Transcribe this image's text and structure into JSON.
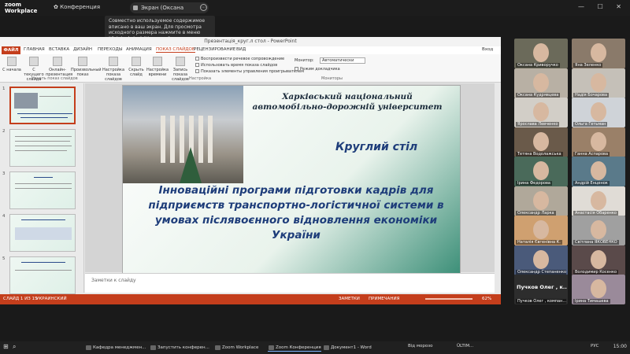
{
  "zoom": {
    "logo_line1": "zoom",
    "logo_line2": "Workplace",
    "conference": "Конференция",
    "share_label": "Экран (Оксана Криворучко)",
    "tooltip": "Совместно используемое содержимое вписано в ваш экран. Для просмотра исходного размера нажмите в меню \"Original size\" (Исходный...",
    "window_controls": "— ☐ ✕"
  },
  "ppt": {
    "title": "Презентація_круг.л стол - PowerPoint",
    "user": "Вход",
    "tabs": [
      "ФАЙЛ",
      "ГЛАВНАЯ",
      "ВСТАВКА",
      "ДИЗАЙН",
      "ПЕРЕХОДЫ",
      "АНИМАЦИЯ",
      "ПОКАЗ СЛАЙДОВ",
      "РЕЦЕНЗИРОВАНИЕ",
      "ВИД"
    ],
    "ribbon": {
      "btn_start": "С начала",
      "btn_current": "С текущего слайда",
      "btn_online": "Онлайн-презентация",
      "btn_custom": "Произвольный показ",
      "btn_setup": "Настройка показа слайдов",
      "btn_hide": "Скрыть слайд",
      "btn_timing": "Настройка времени",
      "btn_record": "Запись показа слайдов",
      "group_start": "Начать показ слайдов",
      "group_setup": "Настройка",
      "group_monitors": "Мониторы",
      "chk_narrations": "Воспроизвести речевое сопровождение",
      "chk_timings": "Использовать время показа слайдов",
      "chk_controls": "Показать элементы управления проигрывателем",
      "monitor_label": "Монитор:",
      "monitor_value": "Автоматически",
      "presenter_view": "Режим докладчика"
    },
    "thumb_nums": [
      "1",
      "2",
      "3",
      "4",
      "5"
    ],
    "slide": {
      "university": "Харківський національний автомобільно-дорожній університет",
      "round_table": "Круглий стіл",
      "main": "Інноваційні програми підготовки кадрів для підприємств транспортно-логістичної системи в умовах післявоєнного відновлення економіки України"
    },
    "notes": "Заметки к слайду",
    "status_left": "СЛАЙД 1 ИЗ 15",
    "status_lang": "УКРАИНСКИЙ",
    "status_notes": "ЗАМЕТКИ",
    "status_comments": "ПРИМЕЧАНИЯ",
    "zoom_pct": "62%"
  },
  "gallery": [
    {
      "name": "Оксана Криворучко",
      "color": "#6b6a5a"
    },
    {
      "name": "Яна Зеленко",
      "color": "#8a7a6a"
    },
    {
      "name": "Оксана Кудрявцева",
      "color": "#b8b0a4"
    },
    {
      "name": "Надія Бочарова",
      "color": "#c5c0b8"
    },
    {
      "name": "Ярослава Левченко",
      "color": "#d2cec7"
    },
    {
      "name": "Ольга Гетьман",
      "color": "#cfd3d8"
    },
    {
      "name": "Тетяна Водолажська",
      "color": "#6a5a4a"
    },
    {
      "name": "Ганна Аспарова",
      "color": "#9a8068"
    },
    {
      "name": "Ірина Федорова",
      "color": "#4a6a5a"
    },
    {
      "name": "Андрій Енценок",
      "color": "#5a7a8a"
    },
    {
      "name": "Олександр Ларка",
      "color": "#b0a89a"
    },
    {
      "name": "Анастасія Обаренко",
      "color": "#e0dcd6"
    },
    {
      "name": "Наталія Євгенівна К.",
      "color": "#cfa070"
    },
    {
      "name": "Світлана ЯКОВЕНКО",
      "color": "#a0a0a0"
    },
    {
      "name": "Олександр Степаненко",
      "color": "#4a5a7a"
    },
    {
      "name": "Володимир Косенко",
      "color": "#5a4a4a"
    },
    {
      "name": "Пучков Олег , компан...",
      "big": "Пучков Олег , к...",
      "plain": true
    },
    {
      "name": "Ірина Тимашева",
      "color": "#9a8a9a"
    }
  ],
  "taskbar": {
    "items": [
      "Кафедра менеджмен...",
      "Запустить конферен...",
      "Zoom Workplace",
      "Zoom Конференция",
      "Документ1 - Word"
    ],
    "weather": "Від морозо",
    "ultim": "ÜLTIM...",
    "lang": "РУС",
    "time": "15:00"
  }
}
